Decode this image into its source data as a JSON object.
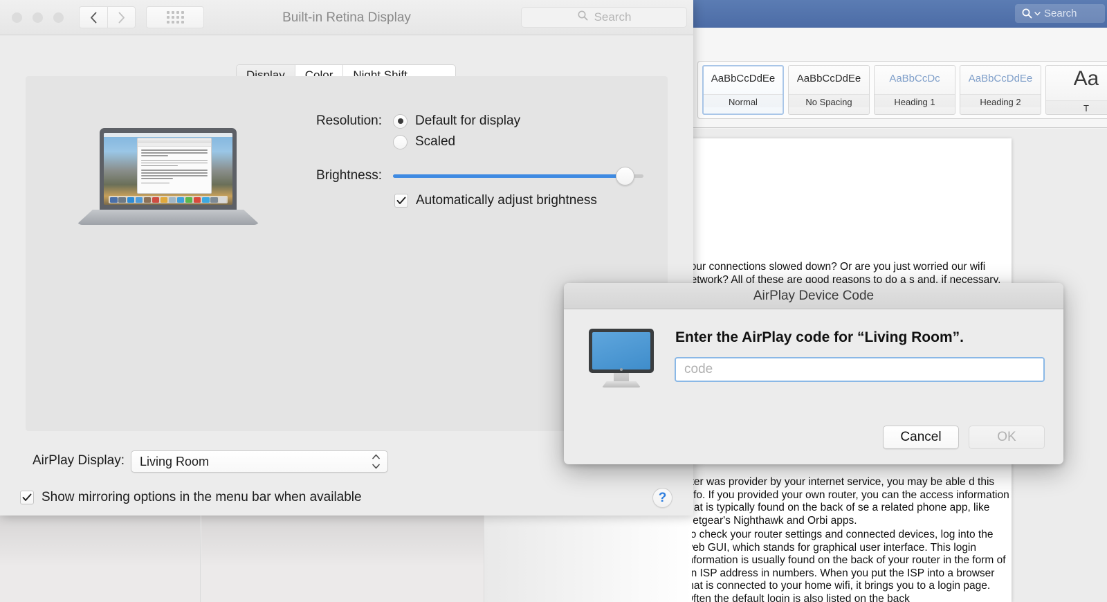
{
  "word_app": {
    "search": {
      "placeholder": "Search",
      "icon": "search-icon"
    },
    "styles": [
      {
        "preview": "AaBbCcDdEe",
        "name": "Normal",
        "kind": "normal",
        "selected": true
      },
      {
        "preview": "AaBbCcDdEe",
        "name": "No Spacing",
        "kind": "normal",
        "selected": false
      },
      {
        "preview": "AaBbCcDc",
        "name": "Heading 1",
        "kind": "heading",
        "selected": false
      },
      {
        "preview": "AaBbCcDdEe",
        "name": "Heading 2",
        "kind": "heading",
        "selected": false
      },
      {
        "preview": "Aa",
        "name": "T",
        "kind": "title",
        "selected": false
      }
    ],
    "document": {
      "paragraph_1": "your connections slowed down?  Or are you just worried our wifi network?  All of these are good reasons to do a s and, if necessary, beef up security to keep those unknown",
      "paragraph_2": "uter was provider by your internet service, you may be able d this info.   If you provided your own router, you can the access information that is typically found on the back of se a related phone app, like Netgear's Nighthawk and Orbi apps.",
      "paragraph_3": "To check your router settings and connected devices, log into the web GUI, which stands for graphical user interface.  This login information is usually found on the back of your router in the form of an ISP address in numbers.  When you put the ISP into a browser that is connected to your home wifi, it brings you to a login page.  Often the default login is also listed on the back"
    }
  },
  "prefs_window": {
    "title": "Built-in Retina Display",
    "search": {
      "placeholder": "Search",
      "icon": "search-icon"
    },
    "toolbar": {
      "back_icon": "chevron-left-icon",
      "forward_icon": "chevron-right-icon",
      "grid_icon": "show-all-grid-icon"
    },
    "tabs": [
      {
        "label": "Display",
        "active": true
      },
      {
        "label": "Color",
        "active": false
      },
      {
        "label": "Night Shift",
        "active": false
      }
    ],
    "resolution": {
      "label": "Resolution:",
      "options": [
        {
          "label": "Default for display",
          "selected": true
        },
        {
          "label": "Scaled",
          "selected": false
        }
      ]
    },
    "brightness": {
      "label": "Brightness:",
      "value_percent": 96,
      "auto_adjust": {
        "label": "Automatically adjust brightness",
        "checked": true
      }
    },
    "airplay": {
      "label": "AirPlay Display:",
      "selected_value": "Living Room",
      "stepper_icon": "updown-chevrons-icon"
    },
    "mirroring": {
      "label": "Show mirroring options in the menu bar when available",
      "checked": true
    },
    "help_button": {
      "label": "?",
      "icon": "help-icon"
    }
  },
  "airplay_dialog": {
    "title": "AirPlay Device Code",
    "icon": "display-monitor-icon",
    "heading": "Enter the AirPlay code for “Living Room”.",
    "code_input": {
      "value": "",
      "placeholder": "code"
    },
    "buttons": [
      {
        "label": "Cancel",
        "enabled": true
      },
      {
        "label": "OK",
        "enabled": false
      }
    ]
  },
  "colors": {
    "accent_blue": "#3e8ae2",
    "word_titlebar": "#4c6ca6",
    "focus_ring": "#8ab8e6",
    "help_blue": "#2f7fe0"
  }
}
